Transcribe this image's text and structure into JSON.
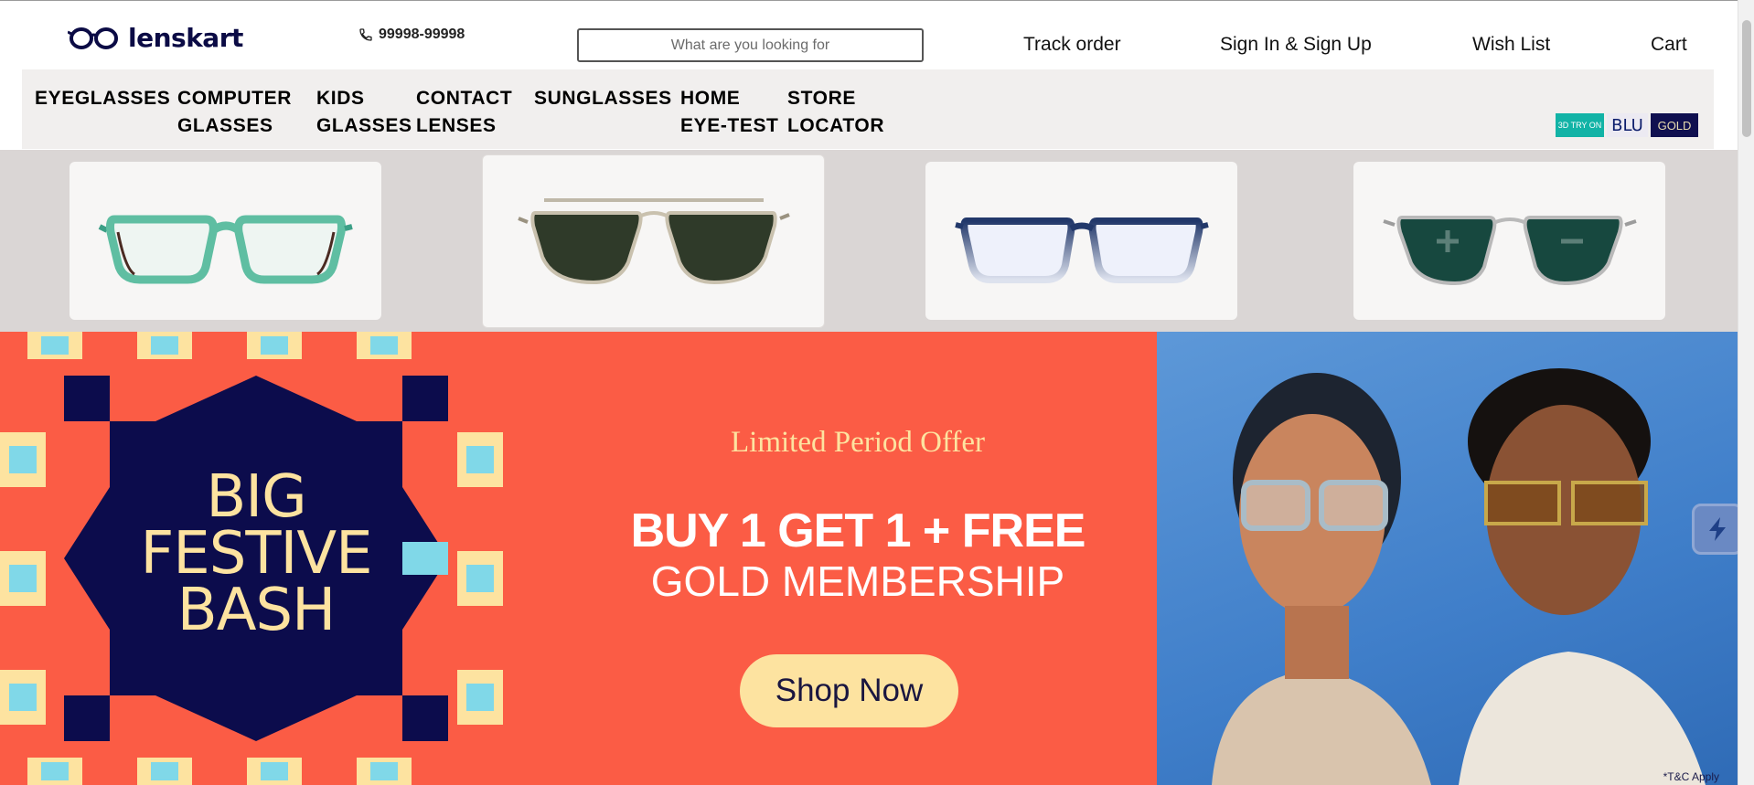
{
  "header": {
    "brand": "lenskart",
    "phone": "99998-99998",
    "search_placeholder": "What are you looking for",
    "links": [
      "Track order",
      "Sign In & Sign Up",
      "Wish List",
      "Cart"
    ]
  },
  "nav": {
    "items": [
      {
        "line1": "EYEGLASSES",
        "line2": ""
      },
      {
        "line1": "COMPUTER",
        "line2": "GLASSES"
      },
      {
        "line1": "KIDS",
        "line2": "GLASSES"
      },
      {
        "line1": "CONTACT",
        "line2": "LENSES"
      },
      {
        "line1": "SUNGLASSES",
        "line2": ""
      },
      {
        "line1": "HOME",
        "line2": "EYE-TEST"
      },
      {
        "line1": "STORE",
        "line2": "LOCATOR"
      }
    ],
    "badges": [
      "3D TRY ON",
      "BLU",
      "GOLD"
    ]
  },
  "categories": [
    {
      "icon": "eyeglasses-icon",
      "frame": "#5fbea2"
    },
    {
      "icon": "sunglasses-icon",
      "frame": "#bfb8a8"
    },
    {
      "icon": "computer-glasses-icon",
      "frame": "#22386a"
    },
    {
      "icon": "power-sunglasses-icon",
      "frame": "#b9b9b9"
    }
  ],
  "banner": {
    "left_title": [
      "BIG",
      "FESTIVE",
      "BASH"
    ],
    "subtitle": "Limited Period Offer",
    "headline": "BUY 1 GET 1 + FREE",
    "subheadline": "GOLD MEMBERSHIP",
    "cta": "Shop Now",
    "terms": "*T&C Apply",
    "colors": {
      "coral": "#fb5c45",
      "navy": "#0c0c4c",
      "cream": "#fde3a0",
      "sky": "#80d8e8"
    }
  }
}
